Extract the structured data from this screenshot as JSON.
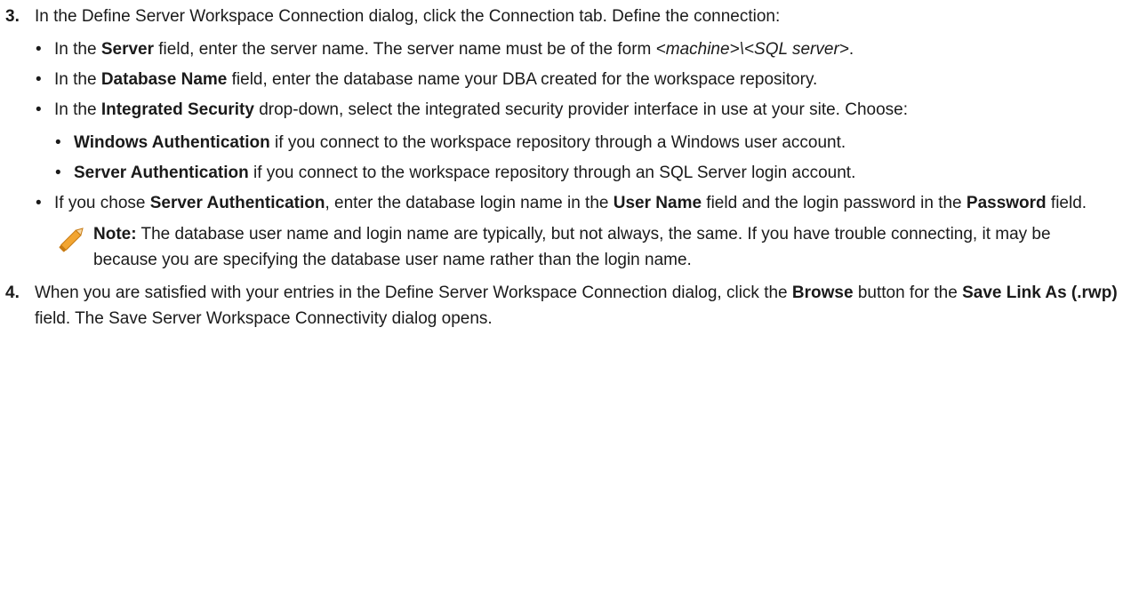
{
  "step3": {
    "number": "3.",
    "intro": "In the Define Server Workspace Connection dialog, click the Connection tab. Define the connection:",
    "bullet_server": {
      "pre": "In the ",
      "bold": "Server",
      "mid": " field, enter the server name. The server name must be of the form ",
      "italic": "<machine>\\<SQL server>",
      "post": "."
    },
    "bullet_dbname": {
      "pre": "In the ",
      "bold": "Database Name",
      "post": " field, enter the database name your DBA created for the workspace repository."
    },
    "bullet_security": {
      "pre": "In the ",
      "bold": "Integrated Security",
      "post": " drop-down, select the integrated security provider interface in use at your site. Choose:"
    },
    "sub_windows": {
      "bold": "Windows Authentication",
      "post": " if you connect to the workspace repository through a Windows user account."
    },
    "sub_server": {
      "bold": "Server Authentication",
      "post": " if you connect to the workspace repository through an SQL Server login account."
    },
    "bullet_chose": {
      "pre": "If you chose ",
      "bold1": "Server Authentication",
      "mid1": ", enter the database login name in the ",
      "bold2": "User Name",
      "mid2": " field and the login password in the ",
      "bold3": "Password",
      "post": " field."
    },
    "note": {
      "label": "Note:",
      "text": " The database user name and login name are typically, but not always, the same. If you have trouble connecting, it may be because you are specifying the database user name rather than the login name.",
      "icon": "pencil-icon"
    }
  },
  "step4": {
    "number": "4.",
    "pre": "When you are satisfied with your entries in the Define Server Workspace Connection dialog, click the ",
    "bold1": "Browse",
    "mid": " button for the ",
    "bold2": "Save Link As (.rwp)",
    "post": " field. The Save Server Workspace Connectivity dialog opens."
  },
  "bullet_glyph": "•",
  "colors": {
    "pencil_body": "#f2a531",
    "pencil_outline": "#c77a12",
    "text": "#1a1a1a"
  }
}
